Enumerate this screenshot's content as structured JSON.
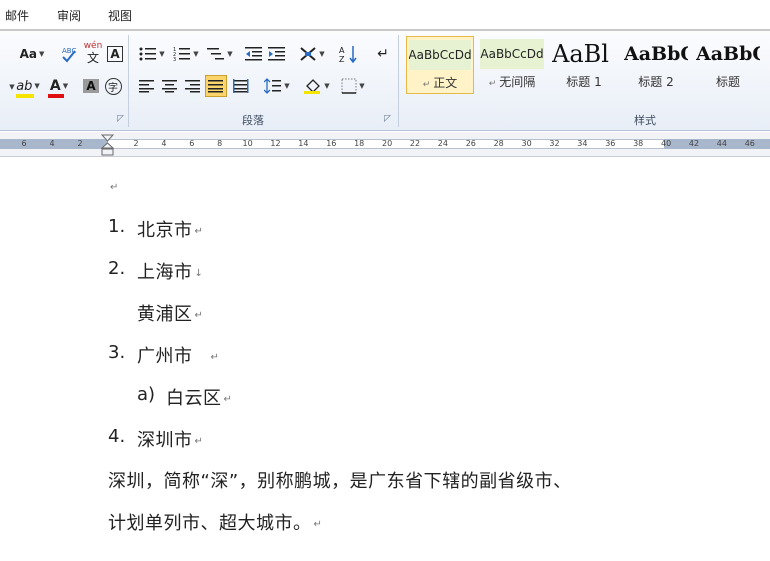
{
  "menu_tabs": [
    "邮件",
    "审阅",
    "视图"
  ],
  "ribbon": {
    "font_group": {
      "font_size_button": "Aa",
      "phonetic_guide": "wén",
      "char_border": "A",
      "text_highlight": "ab",
      "font_color": "A",
      "char_shading": "A",
      "enclose_char": "字"
    },
    "paragraph_group": {
      "label": "段落"
    },
    "styles_group": {
      "label": "样式",
      "styles": [
        {
          "sample": "AaBbCcDd",
          "name": "正文",
          "selected": true
        },
        {
          "sample": "AaBbCcDd",
          "name": "无间隔",
          "selected": false
        },
        {
          "sample": "AaBl",
          "name": "标题 1",
          "selected": false
        },
        {
          "sample": "AaBbC",
          "name": "标题 2",
          "selected": false
        },
        {
          "sample": "AaBbC",
          "name": "标题",
          "selected": false
        }
      ]
    }
  },
  "ruler": {
    "left_numbers": [
      "6",
      "4",
      "2"
    ],
    "right_numbers": [
      "2",
      "4",
      "6",
      "8",
      "10",
      "12",
      "14",
      "16",
      "18",
      "20",
      "22",
      "24",
      "26",
      "28",
      "30",
      "32",
      "34",
      "36",
      "38",
      "40",
      "42",
      "44",
      "46"
    ]
  },
  "document": {
    "paragraph_mark": "↵",
    "list": [
      {
        "number": "1.",
        "text": "北京市"
      },
      {
        "number": "2.",
        "text": "上海市"
      },
      {
        "number": "",
        "text": "黄浦区"
      },
      {
        "number": "3.",
        "text": "广州市"
      },
      {
        "number": "a)",
        "text": "白云区"
      },
      {
        "number": "4.",
        "text": "深圳市"
      }
    ],
    "body_line_1": "深圳，简称“深”，别称鹏城，是广东省下辖的副省级市、",
    "body_line_2": "计划单列市、超大城市。"
  },
  "colors": {
    "highlight": "#f5e400",
    "font_color_bar": "#e01010",
    "selected_style_border": "#e8b949",
    "ribbon_bg": "#e8eef7"
  }
}
